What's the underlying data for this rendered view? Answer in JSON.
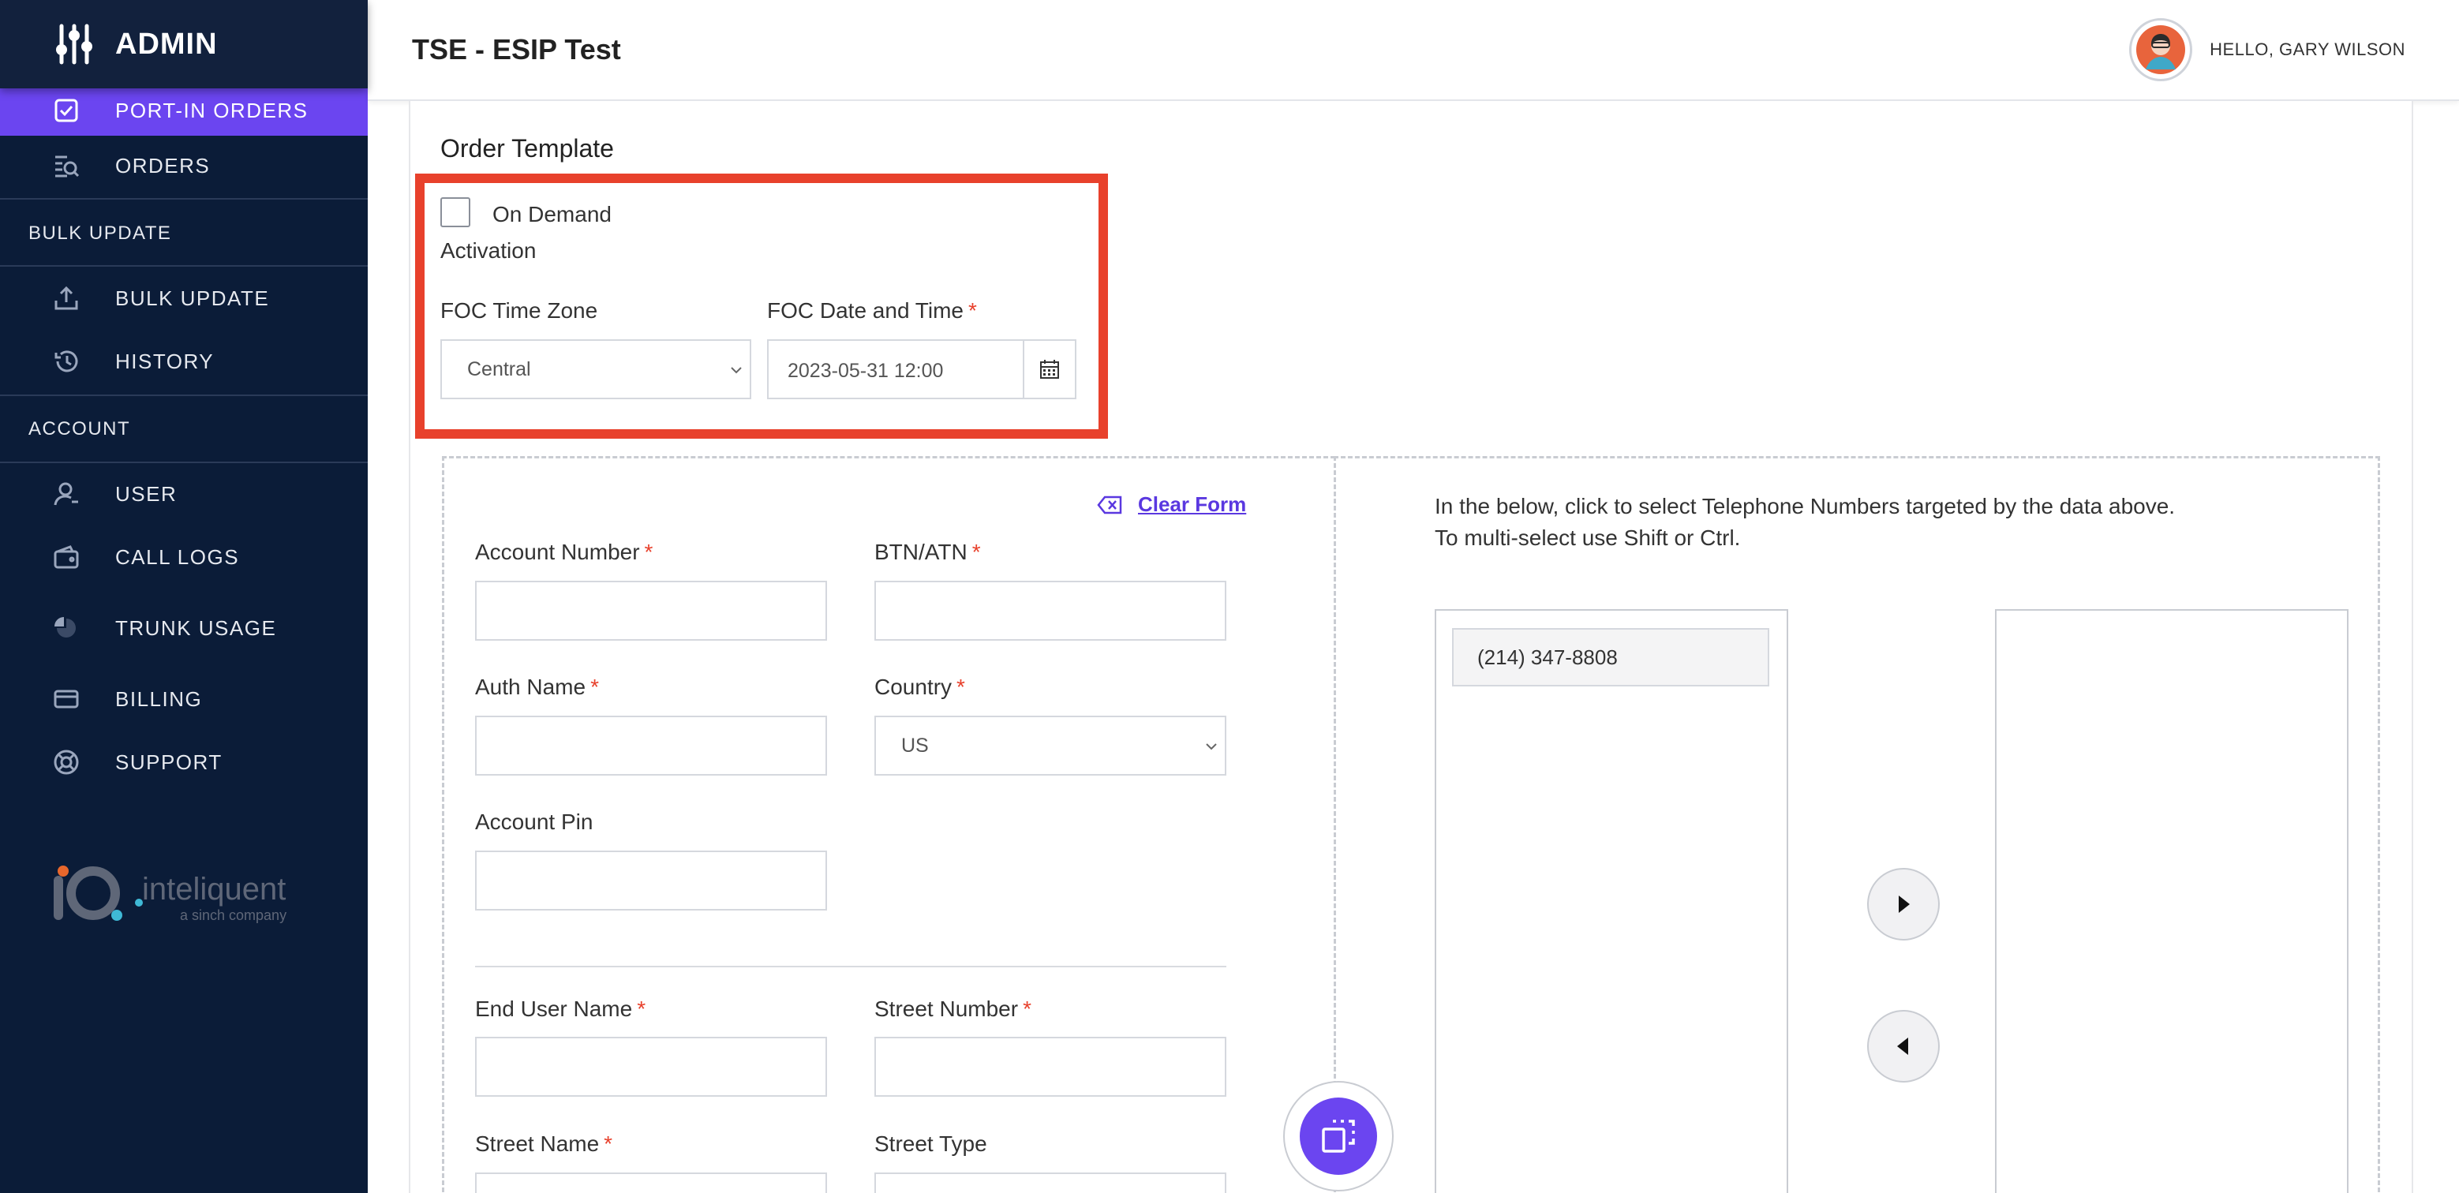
{
  "app": {
    "brand": "ADMIN"
  },
  "header": {
    "title": "TSE - ESIP Test",
    "greeting": "HELLO, GARY WILSON"
  },
  "sidebar": {
    "items": [
      {
        "label": "PORT-IN ORDERS",
        "icon": "checkbox-icon",
        "active": true
      },
      {
        "label": "ORDERS",
        "icon": "search-list-icon"
      },
      {
        "label": "BULK UPDATE",
        "icon": "upload-icon"
      },
      {
        "label": "HISTORY",
        "icon": "history-icon"
      },
      {
        "label": "USER",
        "icon": "user-icon"
      },
      {
        "label": "CALL LOGS",
        "icon": "wallet-icon"
      },
      {
        "label": "TRUNK USAGE",
        "icon": "pie-chart-icon"
      },
      {
        "label": "BILLING",
        "icon": "credit-card-icon"
      },
      {
        "label": "SUPPORT",
        "icon": "lifebuoy-icon"
      }
    ],
    "sections": {
      "bulk_update": "BULK UPDATE",
      "account": "ACCOUNT"
    },
    "logo": {
      "name": "inteliquent",
      "tagline": "a sinch company"
    }
  },
  "order_template": {
    "title": "Order Template",
    "on_demand_line1": "On Demand",
    "on_demand_line2": "Activation",
    "foc_time_zone_label": "FOC Time Zone",
    "foc_time_zone_value": "Central",
    "foc_date_label": "FOC Date and Time",
    "foc_date_value": "2023-05-31 12:00",
    "required_mark": "*"
  },
  "form": {
    "clear_form": "Clear Form",
    "account_number": "Account Number",
    "btn_atn": "BTN/ATN",
    "auth_name": "Auth Name",
    "country": "Country",
    "country_value": "US",
    "account_pin": "Account Pin",
    "end_user_name": "End User Name",
    "street_number": "Street Number",
    "street_name": "Street Name",
    "street_type": "Street Type"
  },
  "tn_panel": {
    "line1": "In the below, click to select Telephone Numbers targeted by the data above.",
    "line2": "To multi-select use Shift or Ctrl.",
    "available": [
      "(214) 347-8808"
    ]
  },
  "colors": {
    "sidebar_bg": "#0b1c38",
    "accent": "#6b45f0",
    "highlight": "#e8412c"
  }
}
